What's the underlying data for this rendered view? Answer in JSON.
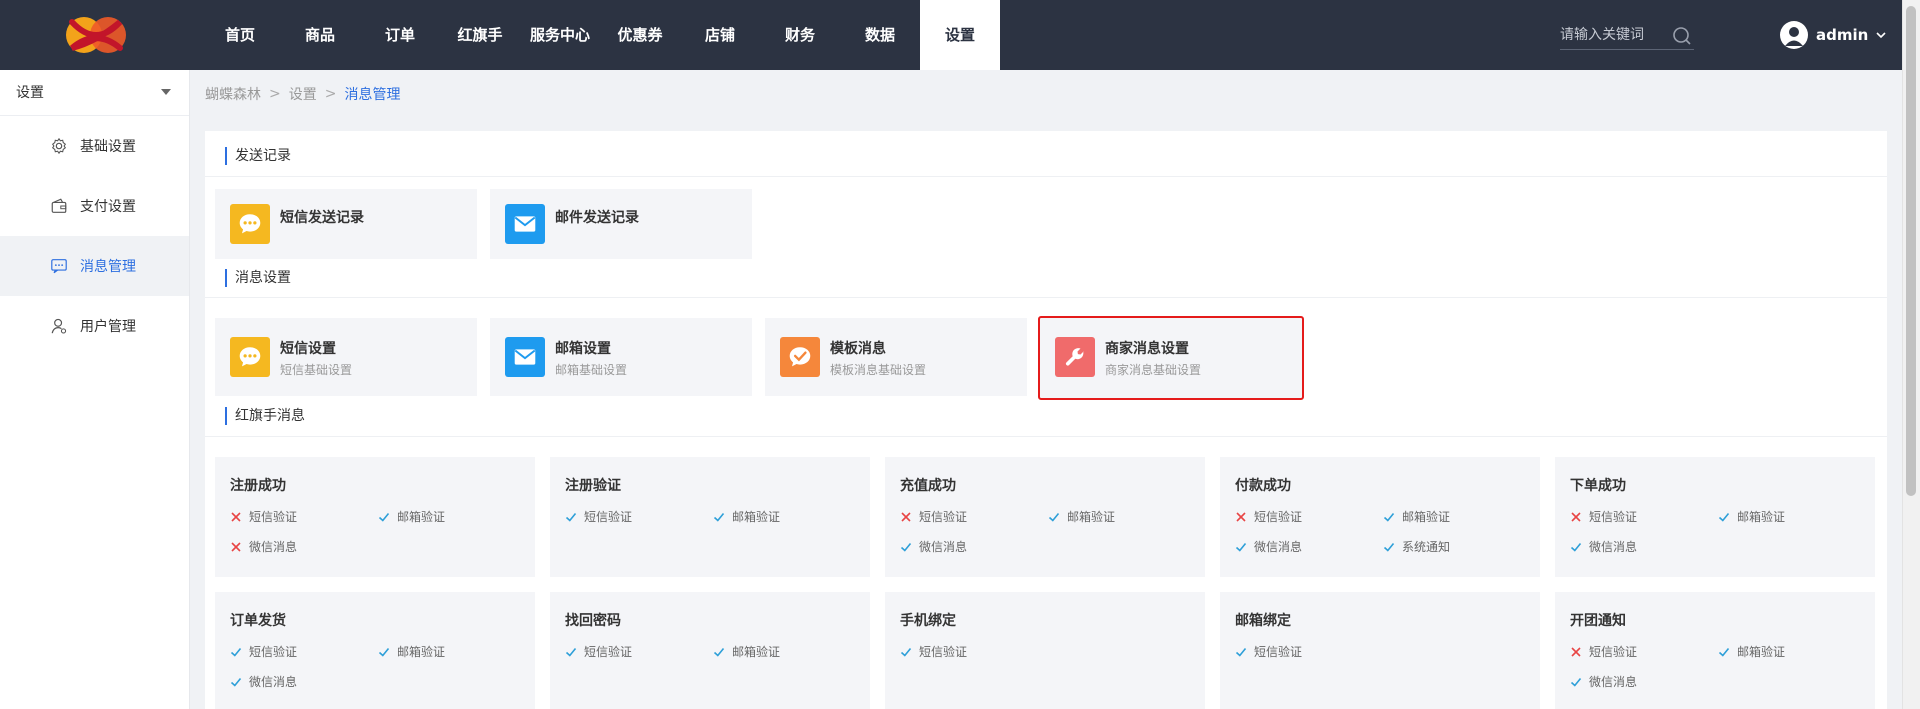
{
  "nav": {
    "items": [
      "首页",
      "商品",
      "订单",
      "红旗手",
      "服务中心",
      "优惠券",
      "店铺",
      "财务",
      "数据",
      "设置"
    ],
    "active_index": 9
  },
  "search": {
    "placeholder": "请输入关键词"
  },
  "user": {
    "name": "admin"
  },
  "sidebar": {
    "select_label": "设置",
    "items": [
      {
        "label": "基础设置",
        "icon": "gear-icon"
      },
      {
        "label": "支付设置",
        "icon": "wallet-icon"
      },
      {
        "label": "消息管理",
        "icon": "message-icon"
      },
      {
        "label": "用户管理",
        "icon": "user-icon"
      }
    ],
    "active_index": 2
  },
  "breadcrumb": {
    "items": [
      "蝴蝶森林",
      "设置",
      "消息管理"
    ],
    "separator": ">"
  },
  "sections": {
    "send_records": {
      "title": "发送记录",
      "cards": [
        {
          "title": "短信发送记录",
          "icon": "chat-icon",
          "color": "#f5b820"
        },
        {
          "title": "邮件发送记录",
          "icon": "mail-icon",
          "color": "#1e9bef"
        }
      ]
    },
    "message_settings": {
      "title": "消息设置",
      "cards": [
        {
          "title": "短信设置",
          "subtitle": "短信基础设置",
          "icon": "chat-icon",
          "color": "#f5b820"
        },
        {
          "title": "邮箱设置",
          "subtitle": "邮箱基础设置",
          "icon": "mail-icon",
          "color": "#1e9bef"
        },
        {
          "title": "模板消息",
          "subtitle": "模板消息基础设置",
          "icon": "template-check-icon",
          "color": "#f5873b"
        },
        {
          "title": "商家消息设置",
          "subtitle": "商家消息基础设置",
          "icon": "wrench-icon",
          "color": "#f06b6b",
          "highlighted": true
        }
      ]
    },
    "hongqishou": {
      "title": "红旗手消息",
      "cards": [
        {
          "title": "注册成功",
          "options": [
            {
              "label": "短信验证",
              "enabled": false
            },
            {
              "label": "邮箱验证",
              "enabled": true
            },
            {
              "label": "微信消息",
              "enabled": false
            }
          ]
        },
        {
          "title": "注册验证",
          "options": [
            {
              "label": "短信验证",
              "enabled": true
            },
            {
              "label": "邮箱验证",
              "enabled": true
            }
          ]
        },
        {
          "title": "充值成功",
          "options": [
            {
              "label": "短信验证",
              "enabled": false
            },
            {
              "label": "邮箱验证",
              "enabled": true
            },
            {
              "label": "微信消息",
              "enabled": true
            }
          ]
        },
        {
          "title": "付款成功",
          "options": [
            {
              "label": "短信验证",
              "enabled": false
            },
            {
              "label": "邮箱验证",
              "enabled": true
            },
            {
              "label": "微信消息",
              "enabled": true
            },
            {
              "label": "系统通知",
              "enabled": true
            }
          ]
        },
        {
          "title": "下单成功",
          "options": [
            {
              "label": "短信验证",
              "enabled": false
            },
            {
              "label": "邮箱验证",
              "enabled": true
            },
            {
              "label": "微信消息",
              "enabled": true
            }
          ]
        },
        {
          "title": "订单发货",
          "options": [
            {
              "label": "短信验证",
              "enabled": true
            },
            {
              "label": "邮箱验证",
              "enabled": true
            },
            {
              "label": "微信消息",
              "enabled": true
            }
          ]
        },
        {
          "title": "找回密码",
          "options": [
            {
              "label": "短信验证",
              "enabled": true
            },
            {
              "label": "邮箱验证",
              "enabled": true
            }
          ]
        },
        {
          "title": "手机绑定",
          "options": [
            {
              "label": "短信验证",
              "enabled": true
            }
          ]
        },
        {
          "title": "邮箱绑定",
          "options": [
            {
              "label": "短信验证",
              "enabled": true
            }
          ]
        },
        {
          "title": "开团通知",
          "options": [
            {
              "label": "短信验证",
              "enabled": false
            },
            {
              "label": "邮箱验证",
              "enabled": true
            },
            {
              "label": "微信消息",
              "enabled": true
            }
          ]
        }
      ]
    }
  },
  "colors": {
    "topbar": "#2c3342",
    "accent": "#2d6fe0",
    "check": "#2d9fd8",
    "cross": "#e84545",
    "highlight_border": "#e51b1b"
  }
}
